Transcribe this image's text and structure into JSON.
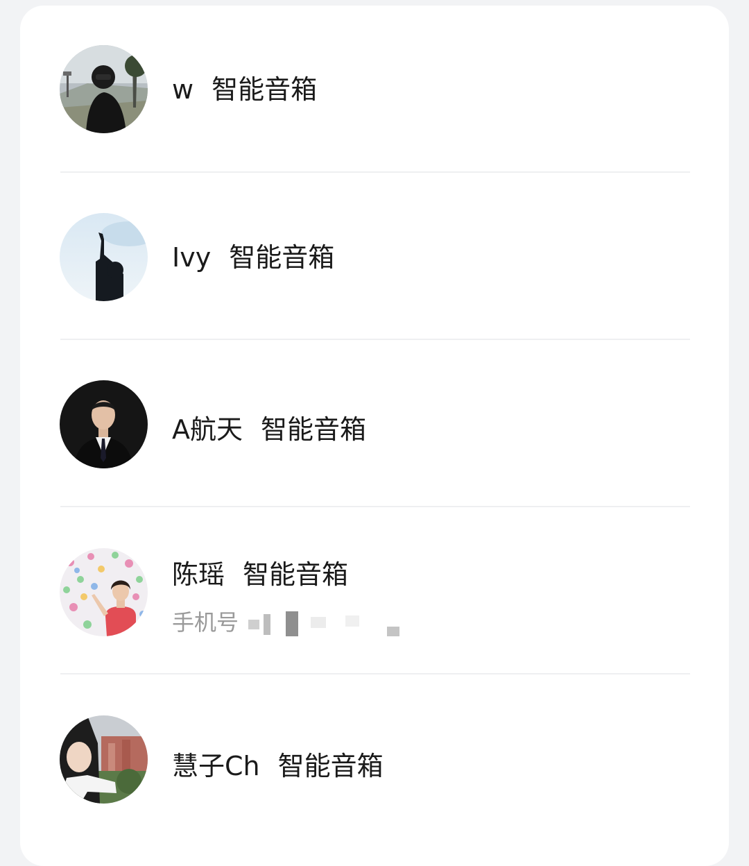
{
  "contacts": [
    {
      "name": "w",
      "tag": "智能音箱",
      "avatar": "avatar-person-dark-jacket-outdoors"
    },
    {
      "name": "Ivy",
      "tag": "智能音箱",
      "avatar": "avatar-silhouette-peace-sign-sky"
    },
    {
      "name": "A航天",
      "tag": "智能音箱",
      "avatar": "avatar-man-black-suit"
    },
    {
      "name": "陈瑶",
      "tag": "智能音箱",
      "phone_label": "手机号",
      "avatar": "avatar-woman-flower-wall"
    },
    {
      "name": "慧子Ch",
      "tag": "智能音箱",
      "avatar": "avatar-woman-city-view"
    }
  ]
}
